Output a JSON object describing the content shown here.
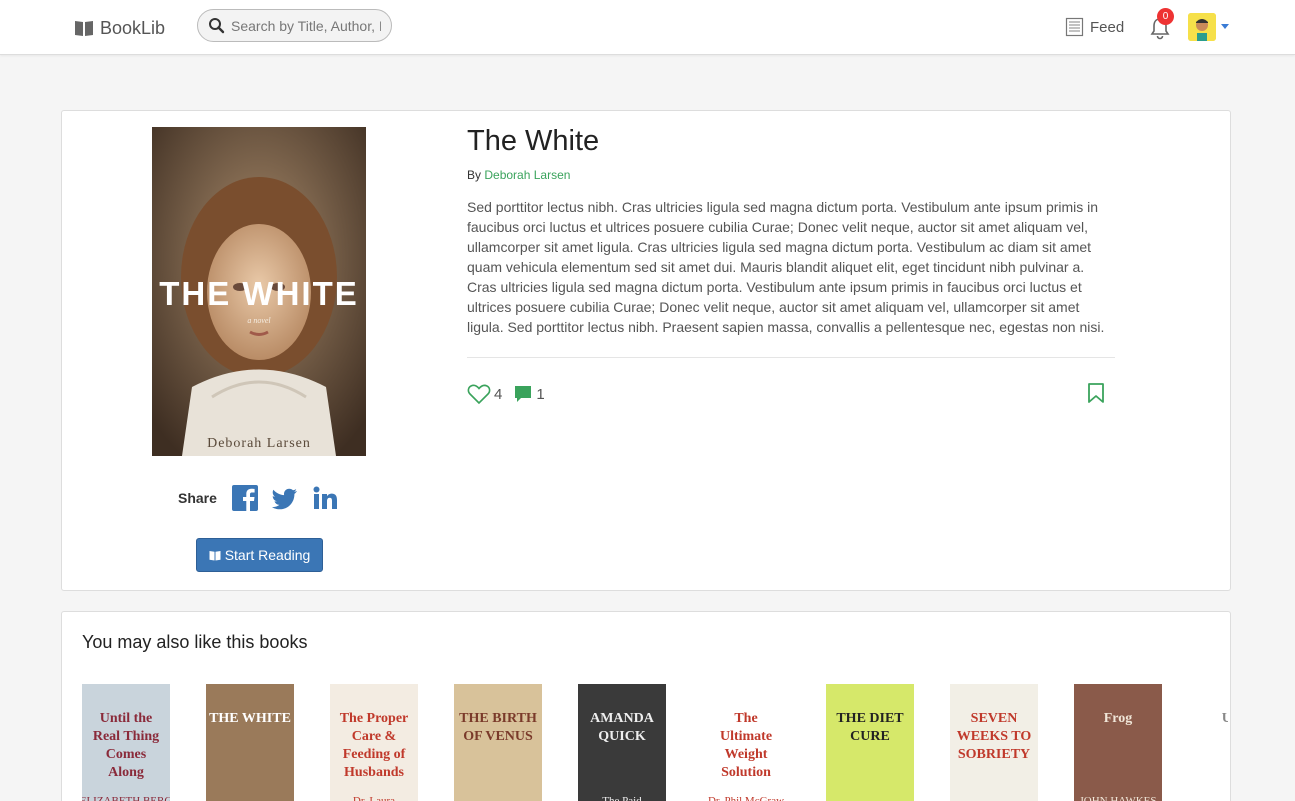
{
  "navbar": {
    "brand": "BookLib",
    "brand_icon": "book-open-icon",
    "search_placeholder": "Search by Title, Author, ISBN",
    "feed_label": "Feed",
    "notification_count": "0"
  },
  "book": {
    "title": "The White",
    "by_label": "By",
    "author": "Deborah Larsen",
    "description": "Sed porttitor lectus nibh. Cras ultricies ligula sed magna dictum porta. Vestibulum ante ipsum primis in faucibus orci luctus et ultrices posuere cubilia Curae; Donec velit neque, auctor sit amet aliquam vel, ullamcorper sit amet ligula. Cras ultricies ligula sed magna dictum porta. Vestibulum ac diam sit amet quam vehicula elementum sed sit amet dui. Mauris blandit aliquet elit, eget tincidunt nibh pulvinar a. Cras ultricies ligula sed magna dictum porta. Vestibulum ante ipsum primis in faucibus orci luctus et ultrices posuere cubilia Curae; Donec velit neque, auctor sit amet aliquam vel, ullamcorper sit amet ligula. Sed porttitor lectus nibh. Praesent sapien massa, convallis a pellentesque nec, egestas non nisi.",
    "likes": "4",
    "comments": "1",
    "cover_title": "THE WHITE",
    "cover_author": "Deborah Larsen",
    "cover_subtitle": "a novel"
  },
  "share": {
    "label": "Share",
    "networks": [
      "facebook-icon",
      "twitter-icon",
      "linkedin-icon"
    ]
  },
  "actions": {
    "start_reading": "Start Reading"
  },
  "recommendations": {
    "heading": "You may also like this books",
    "books": [
      {
        "line1": "Until the Real Thing Comes Along",
        "line2": "ELIZABETH BERG",
        "bg": "#c9d4dc",
        "fg": "#8a2a3a"
      },
      {
        "line1": "THE WHITE",
        "line2": "",
        "bg": "#9a7a5a",
        "fg": "#ffffff"
      },
      {
        "line1": "The Proper Care & Feeding of Husbands",
        "line2": "Dr. Laura",
        "bg": "#f3ece2",
        "fg": "#c0392b"
      },
      {
        "line1": "THE BIRTH OF VENUS",
        "line2": "",
        "bg": "#d8c29a",
        "fg": "#7a3a2a"
      },
      {
        "line1": "AMANDA QUICK",
        "line2": "The Paid",
        "bg": "#3a3a3a",
        "fg": "#eeeeee"
      },
      {
        "line1": "The Ultimate Weight Solution",
        "line2": "Dr. Phil McGraw",
        "bg": "#ffffff",
        "fg": "#c0392b"
      },
      {
        "line1": "THE DIET CURE",
        "line2": "",
        "bg": "#d6e86a",
        "fg": "#222222"
      },
      {
        "line1": "SEVEN WEEKS TO SOBRIETY",
        "line2": "",
        "bg": "#f2efe6",
        "fg": "#c0392b"
      },
      {
        "line1": "Frog",
        "line2": "JOHN HAWKES",
        "bg": "#8a5a4a",
        "fg": "#f0e6d8"
      },
      {
        "line1": "Ursula",
        "line2": "",
        "bg": "#ffffff",
        "fg": "#888888"
      }
    ]
  },
  "colors": {
    "accent_green": "#3aa35c",
    "primary_blue": "#3b76b5",
    "badge_red": "#e33333"
  }
}
